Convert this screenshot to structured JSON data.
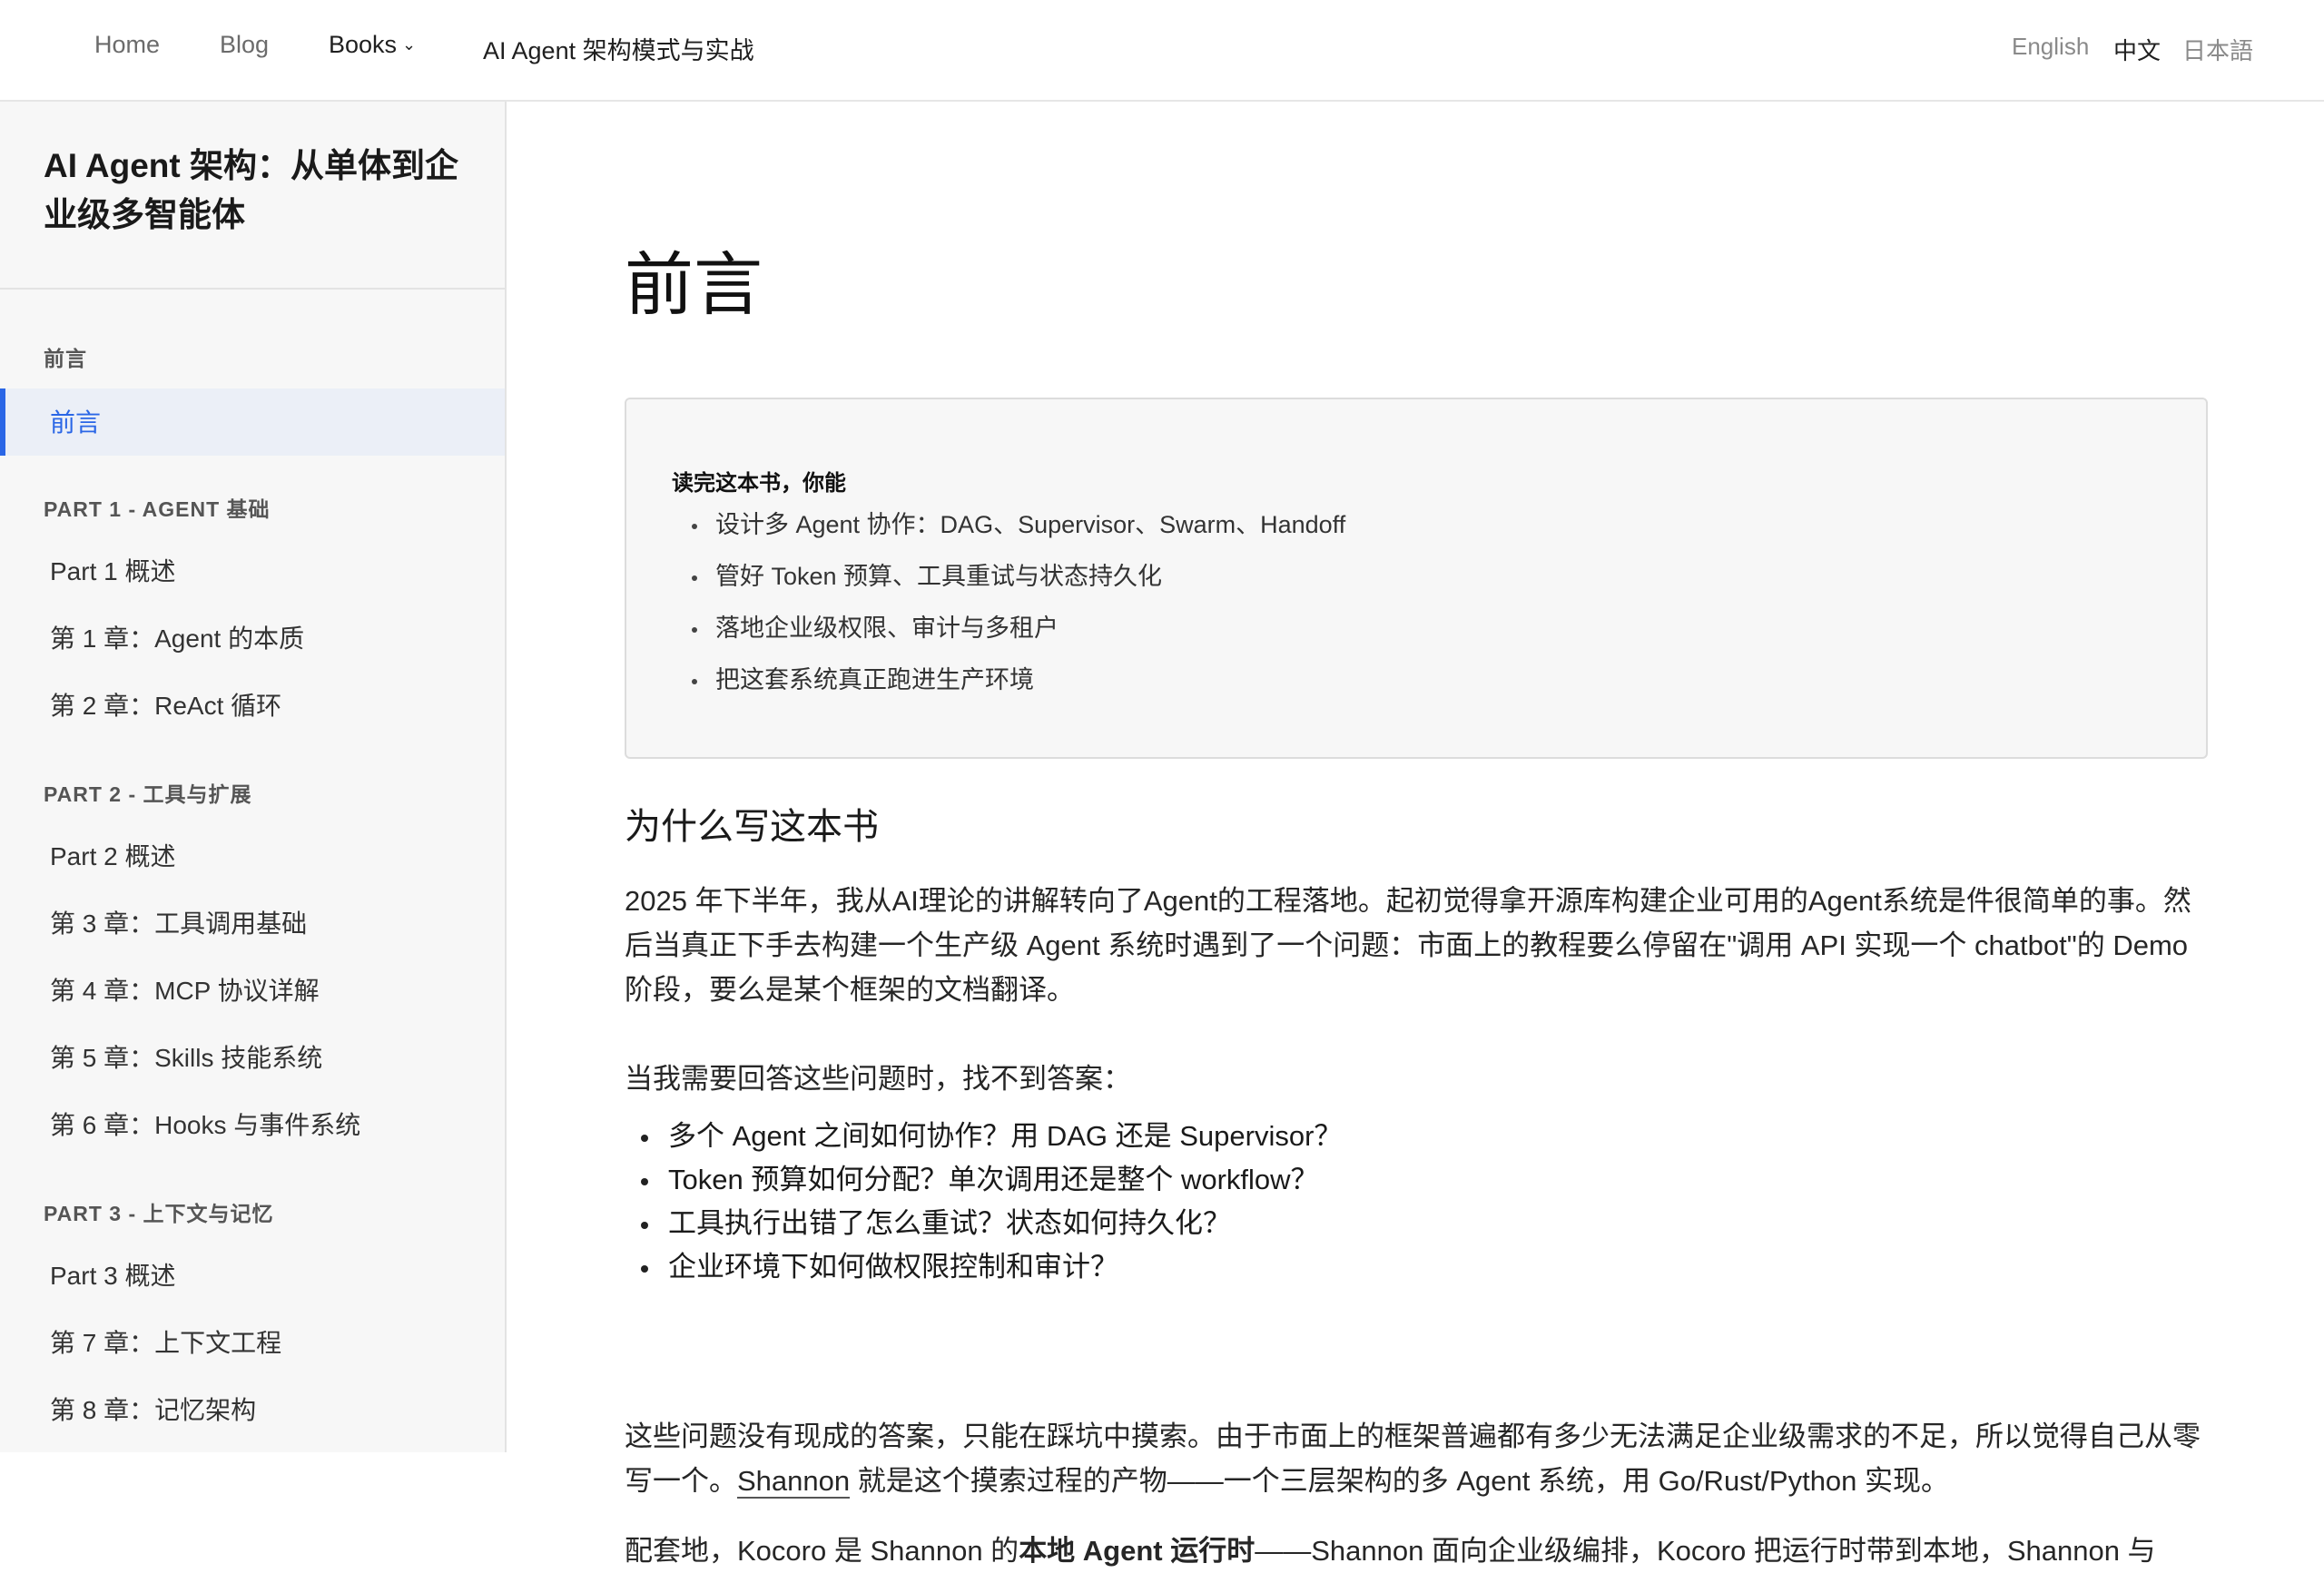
{
  "topnav": {
    "home": "Home",
    "blog": "Blog",
    "books": "Books",
    "books_chevron": "⌄",
    "current_book": "AI Agent 架构模式与实战",
    "languages": [
      "English",
      "中文",
      "日本語"
    ],
    "active_language": "中文"
  },
  "sidebar": {
    "book_title": "AI Agent 架构：从单体到企业级多智能体",
    "sections": [
      {
        "title": "前言",
        "items": [
          "前言"
        ]
      },
      {
        "title": "PART 1 - AGENT 基础",
        "items": [
          "Part 1 概述",
          "第 1 章：Agent 的本质",
          "第 2 章：ReAct 循环"
        ]
      },
      {
        "title": "PART 2 - 工具与扩展",
        "items": [
          "Part 2 概述",
          "第 3 章：工具调用基础",
          "第 4 章：MCP 协议详解",
          "第 5 章：Skills 技能系统",
          "第 6 章：Hooks 与事件系统"
        ]
      },
      {
        "title": "PART 3 - 上下文与记忆",
        "items": [
          "Part 3 概述",
          "第 7 章：上下文工程",
          "第 8 章：记忆架构"
        ]
      }
    ],
    "active_item": "前言"
  },
  "main": {
    "title": "前言",
    "callout": {
      "title": "读完这本书，你能",
      "items": [
        "设计多 Agent 协作：DAG、Supervisor、Swarm、Handoff",
        "管好 Token 预算、工具重试与状态持久化",
        "落地企业级权限、审计与多租户",
        "把这套系统真正跑进生产环境"
      ]
    },
    "section_heading": "为什么写这本书",
    "para1": "2025 年下半年，我从AI理论的讲解转向了Agent的工程落地。起初觉得拿开源库构建企业可用的Agent系统是件很简单的事。然后当真正下手去构建一个生产级 Agent 系统时遇到了一个问题：市面上的教程要么停留在\"调用 API 实现一个 chatbot\"的 Demo 阶段，要么是某个框架的文档翻译。",
    "para2": "当我需要回答这些问题时，找不到答案：",
    "questions": [
      "多个 Agent 之间如何协作？用 DAG 还是 Supervisor？",
      "Token 预算如何分配？单次调用还是整个 workflow？",
      "工具执行出错了怎么重试？状态如何持久化？",
      "企业环境下如何做权限控制和审计？"
    ],
    "para3_before_link": "这些问题没有现成的答案，只能在踩坑中摸索。由于市面上的框架普遍都有多少无法满足企业级需求的不足，所以觉得自己从零写一个。",
    "para3_link": "Shannon",
    "para3_after_link": " 就是这个摸索过程的产物——一个三层架构的多 Agent 系统，用 Go/Rust/Python 实现。",
    "para4_start": "配套地，Kocoro 是 Shannon 的",
    "para4_bold": "本地 Agent 运行时",
    "para4_end": "——Shannon 面向企业级编排，Kocoro 把运行时带到本地，Shannon 与"
  }
}
